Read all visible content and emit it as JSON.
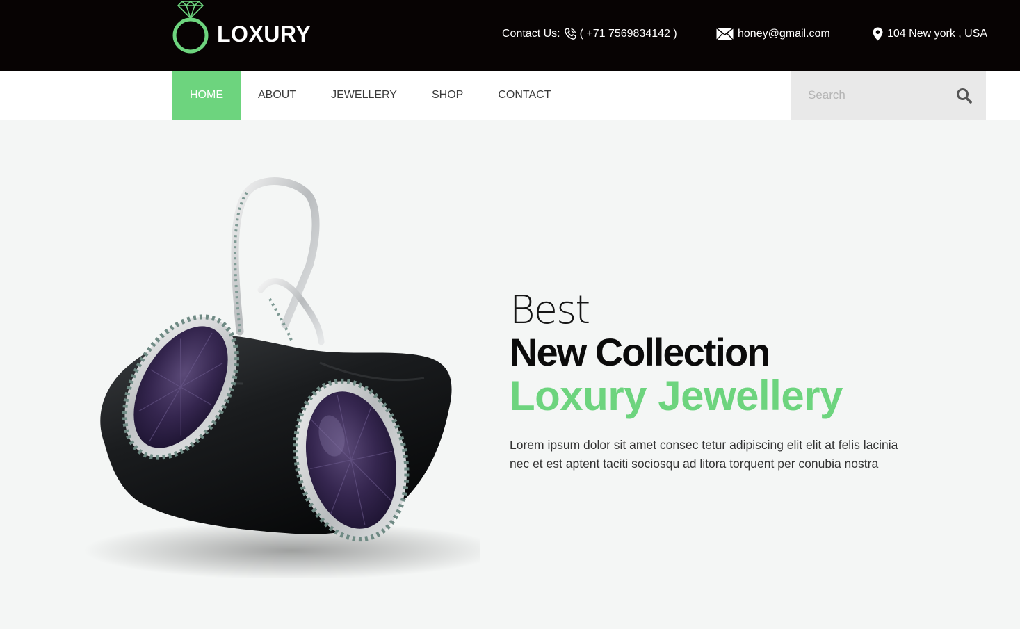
{
  "brand": {
    "name": "LOXURY",
    "accent_color": "#6dd47e",
    "topbar_color": "#070303"
  },
  "contact": {
    "label": "Contact Us:",
    "phone": "( +71 7569834142 )",
    "email": "honey@gmail.com",
    "address": "104 New york , USA"
  },
  "nav": {
    "items": [
      {
        "label": "HOME",
        "active": true
      },
      {
        "label": "ABOUT",
        "active": false
      },
      {
        "label": "JEWELLERY",
        "active": false
      },
      {
        "label": "SHOP",
        "active": false
      },
      {
        "label": "CONTACT",
        "active": false
      }
    ]
  },
  "search": {
    "placeholder": "Search",
    "value": "",
    "icon": "search-icon"
  },
  "hero": {
    "line1": "Best",
    "line2": "New Collection",
    "line3": "Loxury Jewellery",
    "description": "Lorem ipsum dolor sit amet consec tetur adipiscing elit elit at felis lacinia nec et est aptent taciti sociosqu ad litora torquent per conubia nostra"
  },
  "icons": {
    "logo": "diamond-ring-icon",
    "phone": "phone-icon",
    "mail": "envelope-icon",
    "location": "map-pin-icon"
  }
}
